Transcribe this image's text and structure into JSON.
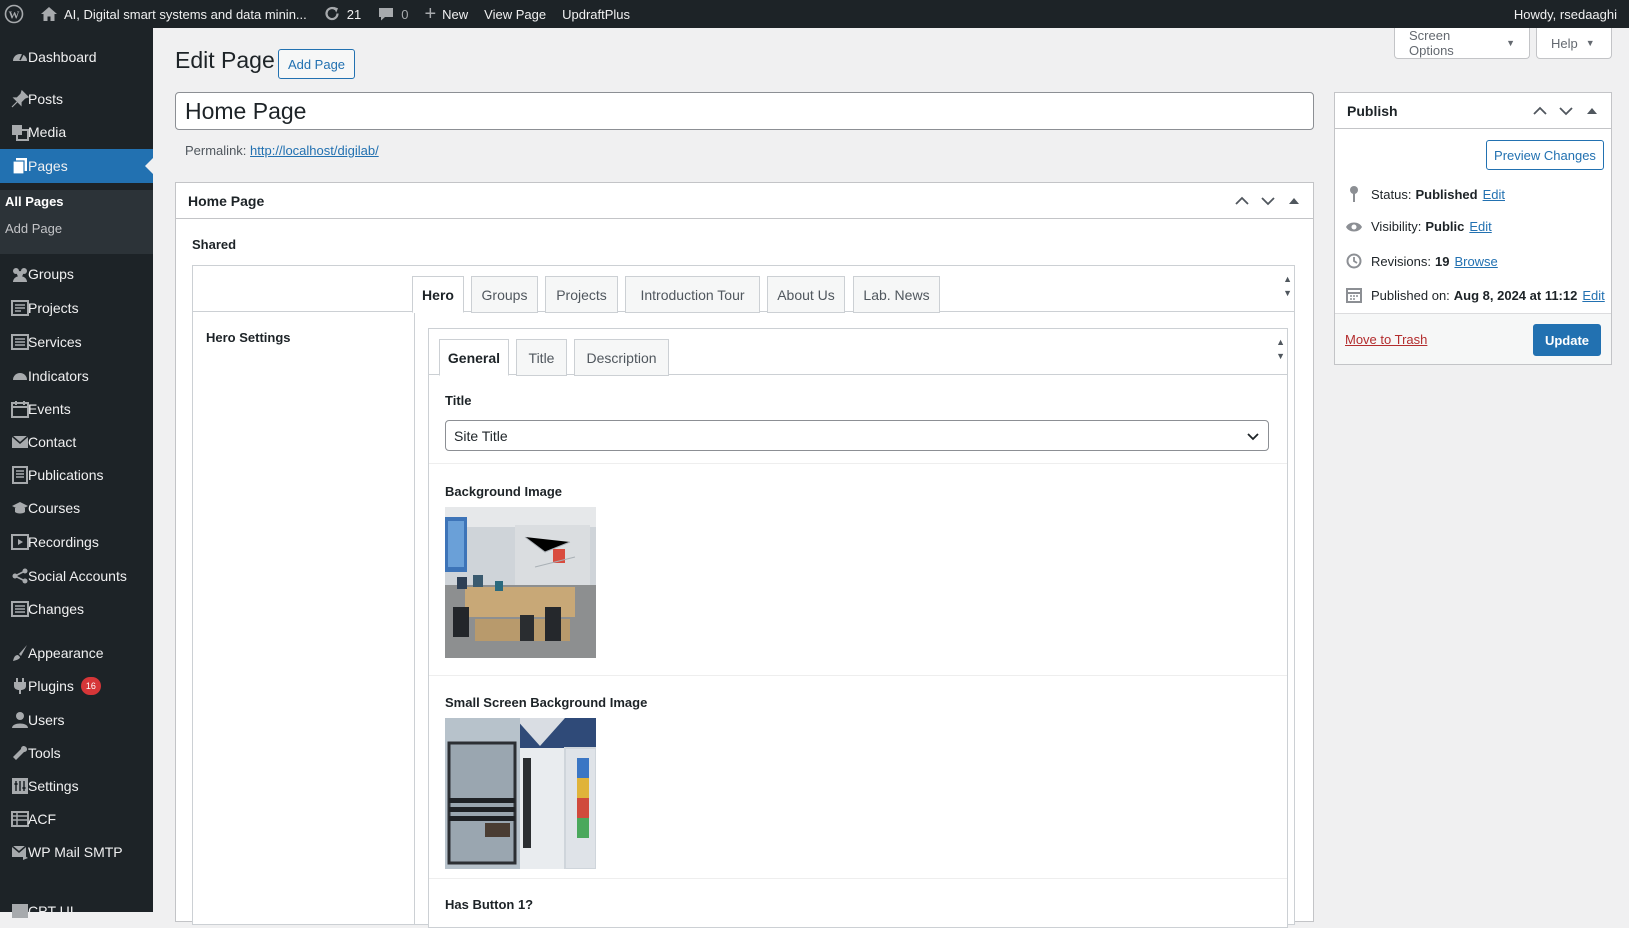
{
  "admin_bar": {
    "site_name": "AI, Digital smart systems and data minin...",
    "updates_count": "21",
    "comments_count": "0",
    "new_label": "New",
    "view_page_label": "View Page",
    "plugin_label": "UpdraftPlus",
    "howdy": "Howdy, rsedaaghi"
  },
  "sidebar": {
    "items": [
      {
        "label": "Dashboard",
        "icon": "dashboard-icon"
      },
      {
        "label": "Posts",
        "icon": "pin-icon"
      },
      {
        "label": "Media",
        "icon": "media-icon"
      },
      {
        "label": "Pages",
        "icon": "pages-icon"
      },
      {
        "label": "Groups",
        "icon": "groups-icon"
      },
      {
        "label": "Projects",
        "icon": "projects-icon"
      },
      {
        "label": "Services",
        "icon": "services-icon"
      },
      {
        "label": "Indicators",
        "icon": "indicators-icon"
      },
      {
        "label": "Events",
        "icon": "events-icon"
      },
      {
        "label": "Contact",
        "icon": "mail-icon"
      },
      {
        "label": "Publications",
        "icon": "publications-icon"
      },
      {
        "label": "Courses",
        "icon": "courses-icon"
      },
      {
        "label": "Recordings",
        "icon": "recordings-icon"
      },
      {
        "label": "Social Accounts",
        "icon": "share-icon"
      },
      {
        "label": "Changes",
        "icon": "changes-icon"
      },
      {
        "label": "Appearance",
        "icon": "appearance-icon"
      },
      {
        "label": "Plugins",
        "icon": "plugins-icon",
        "badge": "16"
      },
      {
        "label": "Users",
        "icon": "users-icon"
      },
      {
        "label": "Tools",
        "icon": "tools-icon"
      },
      {
        "label": "Settings",
        "icon": "settings-icon"
      },
      {
        "label": "ACF",
        "icon": "acf-icon"
      },
      {
        "label": "WP Mail SMTP",
        "icon": "mail-smtp-icon"
      },
      {
        "label": "CPT UI",
        "icon": "cptui-icon"
      }
    ],
    "submenu": [
      "All Pages",
      "Add Page"
    ]
  },
  "screen_options": {
    "screen_options_label": "Screen Options",
    "help_label": "Help"
  },
  "header": {
    "title": "Edit Page",
    "add_page_label": "Add Page"
  },
  "editor": {
    "title_value": "Home Page",
    "permalink_label": "Permalink:",
    "permalink_url": "http://localhost/digilab/"
  },
  "main_box": {
    "title": "Home Page",
    "shared_label": "Shared",
    "tabs": [
      "Hero",
      "Groups",
      "Projects",
      "Introduction Tour",
      "About Us",
      "Lab. News"
    ],
    "hero_settings_label": "Hero Settings",
    "inner_tabs": [
      "General",
      "Title",
      "Description"
    ],
    "title_field_label": "Title",
    "title_select_value": "Site Title",
    "bg_image_label": "Background Image",
    "small_bg_image_label": "Small Screen Background Image",
    "has_button_label": "Has Button 1?"
  },
  "publish": {
    "title": "Publish",
    "preview_label": "Preview Changes",
    "status_label": "Status:",
    "status_value": "Published",
    "visibility_label": "Visibility:",
    "visibility_value": "Public",
    "revisions_label": "Revisions:",
    "revisions_value": "19",
    "browse_label": "Browse",
    "published_on_label": "Published on:",
    "published_on_value": "Aug 8, 2024 at 11:12",
    "edit_label": "Edit",
    "trash_label": "Move to Trash",
    "update_label": "Update"
  },
  "colors": {
    "admin_bar": "#1d2327",
    "accent": "#2271b1",
    "badge": "#d63638",
    "trash": "#b32d2e"
  }
}
